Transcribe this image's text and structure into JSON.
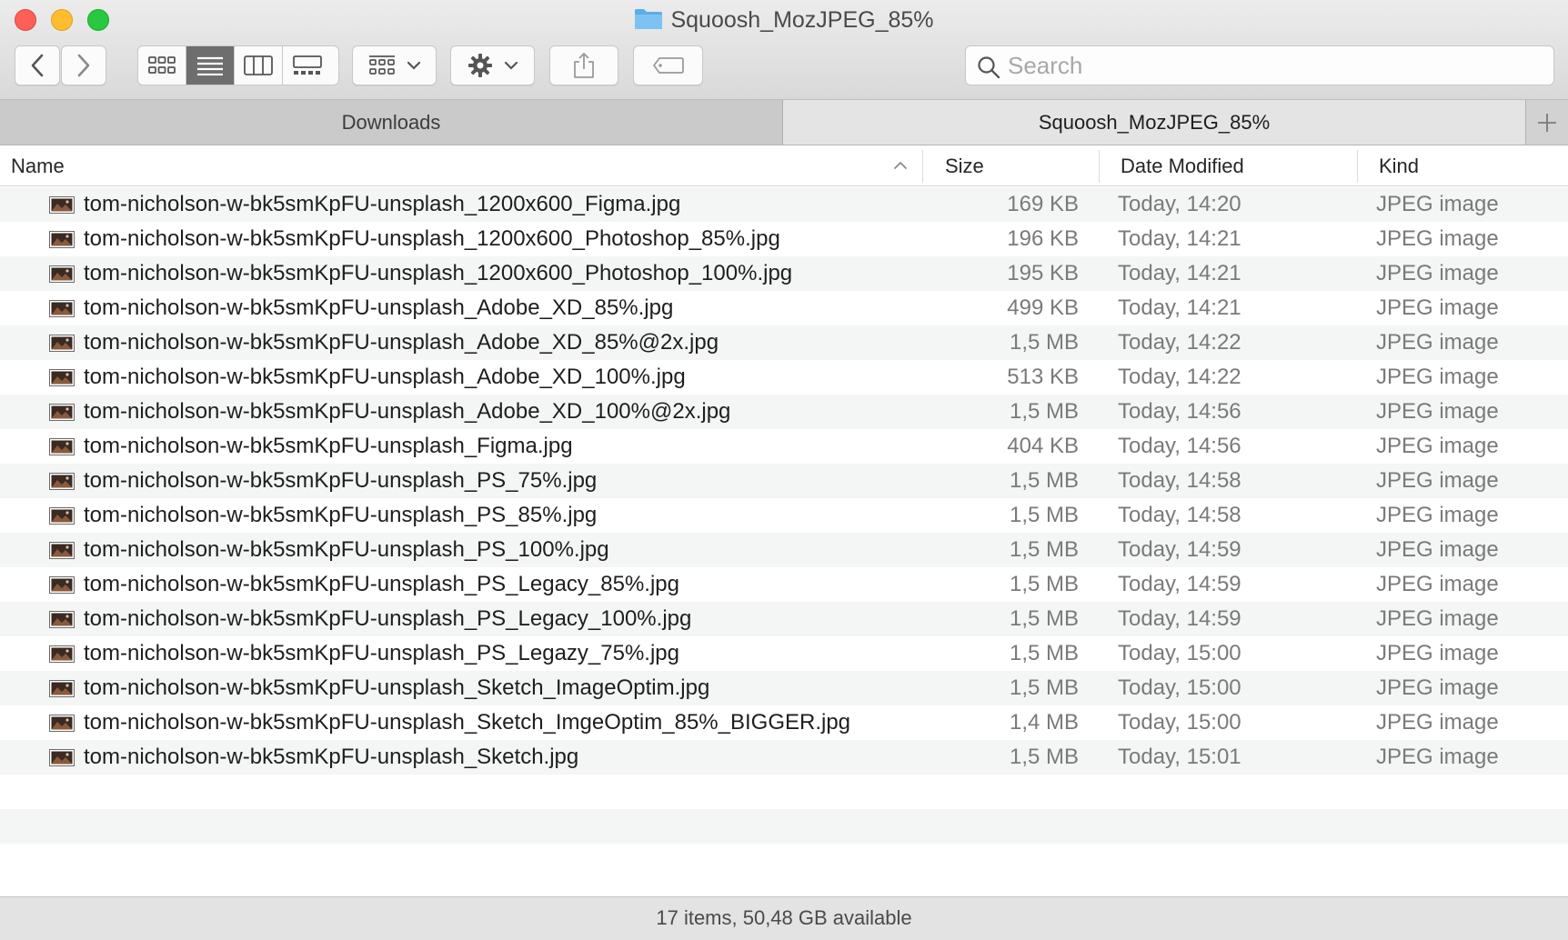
{
  "window": {
    "title": "Squoosh_MozJPEG_85%"
  },
  "toolbar": {
    "search_placeholder": "Search",
    "view_mode_selected": "list"
  },
  "tabs": [
    {
      "label": "Downloads",
      "active": false
    },
    {
      "label": "Squoosh_MozJPEG_85%",
      "active": true
    }
  ],
  "columns": {
    "name": "Name",
    "size": "Size",
    "date": "Date Modified",
    "kind": "Kind"
  },
  "files": [
    {
      "name": "tom-nicholson-w-bk5smKpFU-unsplash_1200x600_Figma.jpg",
      "size": "169 KB",
      "date": "Today, 14:20",
      "kind": "JPEG image"
    },
    {
      "name": "tom-nicholson-w-bk5smKpFU-unsplash_1200x600_Photoshop_85%.jpg",
      "size": "196 KB",
      "date": "Today, 14:21",
      "kind": "JPEG image"
    },
    {
      "name": "tom-nicholson-w-bk5smKpFU-unsplash_1200x600_Photoshop_100%.jpg",
      "size": "195 KB",
      "date": "Today, 14:21",
      "kind": "JPEG image"
    },
    {
      "name": "tom-nicholson-w-bk5smKpFU-unsplash_Adobe_XD_85%.jpg",
      "size": "499 KB",
      "date": "Today, 14:21",
      "kind": "JPEG image"
    },
    {
      "name": "tom-nicholson-w-bk5smKpFU-unsplash_Adobe_XD_85%@2x.jpg",
      "size": "1,5 MB",
      "date": "Today, 14:22",
      "kind": "JPEG image"
    },
    {
      "name": "tom-nicholson-w-bk5smKpFU-unsplash_Adobe_XD_100%.jpg",
      "size": "513 KB",
      "date": "Today, 14:22",
      "kind": "JPEG image"
    },
    {
      "name": "tom-nicholson-w-bk5smKpFU-unsplash_Adobe_XD_100%@2x.jpg",
      "size": "1,5 MB",
      "date": "Today, 14:56",
      "kind": "JPEG image"
    },
    {
      "name": "tom-nicholson-w-bk5smKpFU-unsplash_Figma.jpg",
      "size": "404 KB",
      "date": "Today, 14:56",
      "kind": "JPEG image"
    },
    {
      "name": "tom-nicholson-w-bk5smKpFU-unsplash_PS_75%.jpg",
      "size": "1,5 MB",
      "date": "Today, 14:58",
      "kind": "JPEG image"
    },
    {
      "name": "tom-nicholson-w-bk5smKpFU-unsplash_PS_85%.jpg",
      "size": "1,5 MB",
      "date": "Today, 14:58",
      "kind": "JPEG image"
    },
    {
      "name": "tom-nicholson-w-bk5smKpFU-unsplash_PS_100%.jpg",
      "size": "1,5 MB",
      "date": "Today, 14:59",
      "kind": "JPEG image"
    },
    {
      "name": "tom-nicholson-w-bk5smKpFU-unsplash_PS_Legacy_85%.jpg",
      "size": "1,5 MB",
      "date": "Today, 14:59",
      "kind": "JPEG image"
    },
    {
      "name": "tom-nicholson-w-bk5smKpFU-unsplash_PS_Legacy_100%.jpg",
      "size": "1,5 MB",
      "date": "Today, 14:59",
      "kind": "JPEG image"
    },
    {
      "name": "tom-nicholson-w-bk5smKpFU-unsplash_PS_Legazy_75%.jpg",
      "size": "1,5 MB",
      "date": "Today, 15:00",
      "kind": "JPEG image"
    },
    {
      "name": "tom-nicholson-w-bk5smKpFU-unsplash_Sketch_ImageOptim.jpg",
      "size": "1,5 MB",
      "date": "Today, 15:00",
      "kind": "JPEG image"
    },
    {
      "name": "tom-nicholson-w-bk5smKpFU-unsplash_Sketch_ImgeOptim_85%_BIGGER.jpg",
      "size": "1,4 MB",
      "date": "Today, 15:00",
      "kind": "JPEG image"
    },
    {
      "name": "tom-nicholson-w-bk5smKpFU-unsplash_Sketch.jpg",
      "size": "1,5 MB",
      "date": "Today, 15:01",
      "kind": "JPEG image"
    }
  ],
  "status": {
    "text": "17 items, 50,48 GB available"
  },
  "colors": {
    "close": "#fe5f57",
    "minimize": "#febc2e",
    "zoom": "#28c840",
    "folder": "#6cb8ef",
    "active_view": "#6e6e6e"
  }
}
